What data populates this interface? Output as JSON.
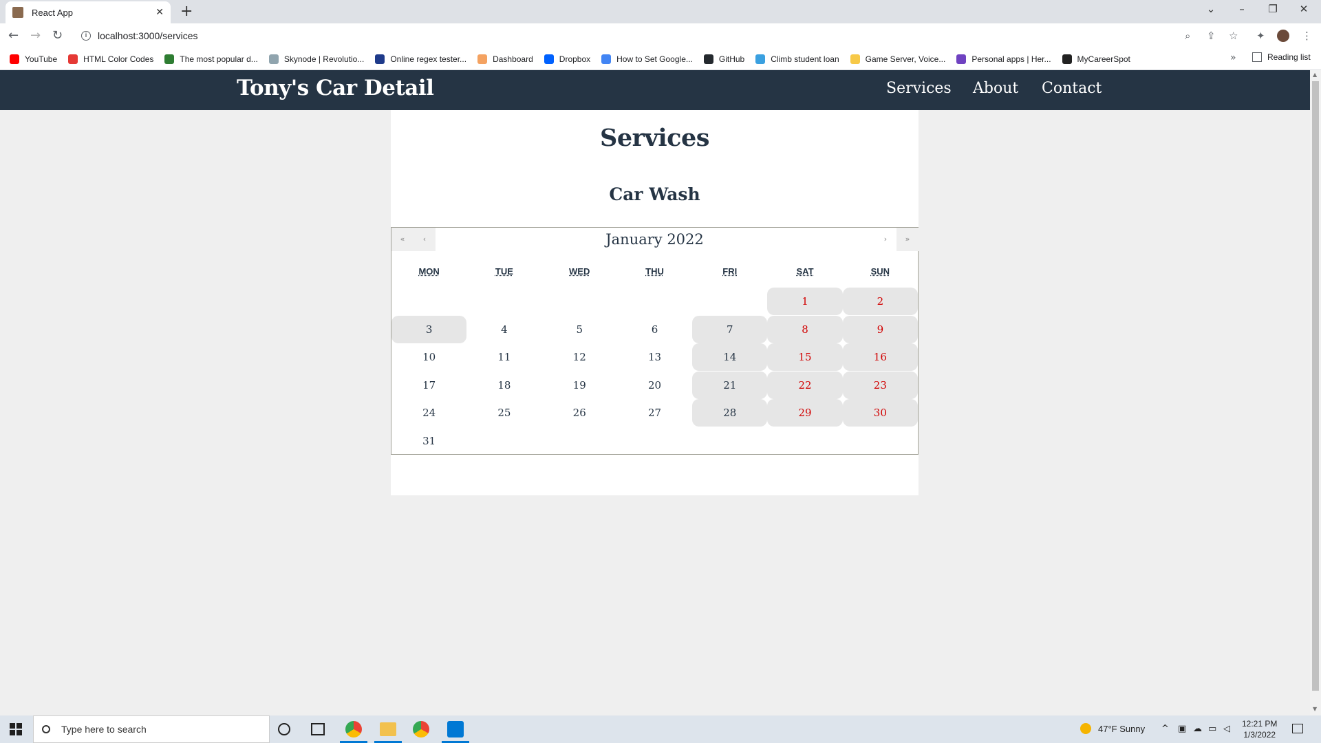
{
  "browser": {
    "tab_title": "React App",
    "url": "localhost:3000/services",
    "bookmarks": [
      {
        "label": "YouTube",
        "color": "#ff0000"
      },
      {
        "label": "HTML Color Codes",
        "color": "#e53935"
      },
      {
        "label": "The most popular d...",
        "color": "#2e7d32"
      },
      {
        "label": "Skynode | Revolutio...",
        "color": "#90a4ae"
      },
      {
        "label": "Online regex tester...",
        "color": "#1e3a8a"
      },
      {
        "label": "Dashboard",
        "color": "#f4a261"
      },
      {
        "label": "Dropbox",
        "color": "#0061fe"
      },
      {
        "label": "How to Set Google...",
        "color": "#4285f4"
      },
      {
        "label": "GitHub",
        "color": "#24292e"
      },
      {
        "label": "Climb student loan",
        "color": "#3aa0e0"
      },
      {
        "label": "Game Server, Voice...",
        "color": "#f7c948"
      },
      {
        "label": "Personal apps | Her...",
        "color": "#6f42c1"
      },
      {
        "label": "MyCareerSpot",
        "color": "#222222"
      }
    ],
    "reading_list": "Reading list"
  },
  "site": {
    "brand": "Tony's Car Detail",
    "nav": [
      "Services",
      "About",
      "Contact"
    ],
    "page_title": "Services",
    "service_title": "Car Wash"
  },
  "calendar": {
    "label": "January 2022",
    "nav": {
      "prev2": "«",
      "prev": "‹",
      "next": "›",
      "next2": "»"
    },
    "weekdays": [
      "MON",
      "TUE",
      "WED",
      "THU",
      "FRI",
      "SAT",
      "SUN"
    ],
    "first_weekday_index": 5,
    "days_in_month": 31,
    "weekend_color": "#d10000",
    "highlighted_days": [
      1,
      2,
      3,
      7,
      8,
      9,
      14,
      15,
      16,
      21,
      22,
      23,
      28,
      29,
      30
    ]
  },
  "taskbar": {
    "search_placeholder": "Type here to search",
    "weather": "47°F  Sunny",
    "time": "12:21 PM",
    "date": "1/3/2022"
  }
}
